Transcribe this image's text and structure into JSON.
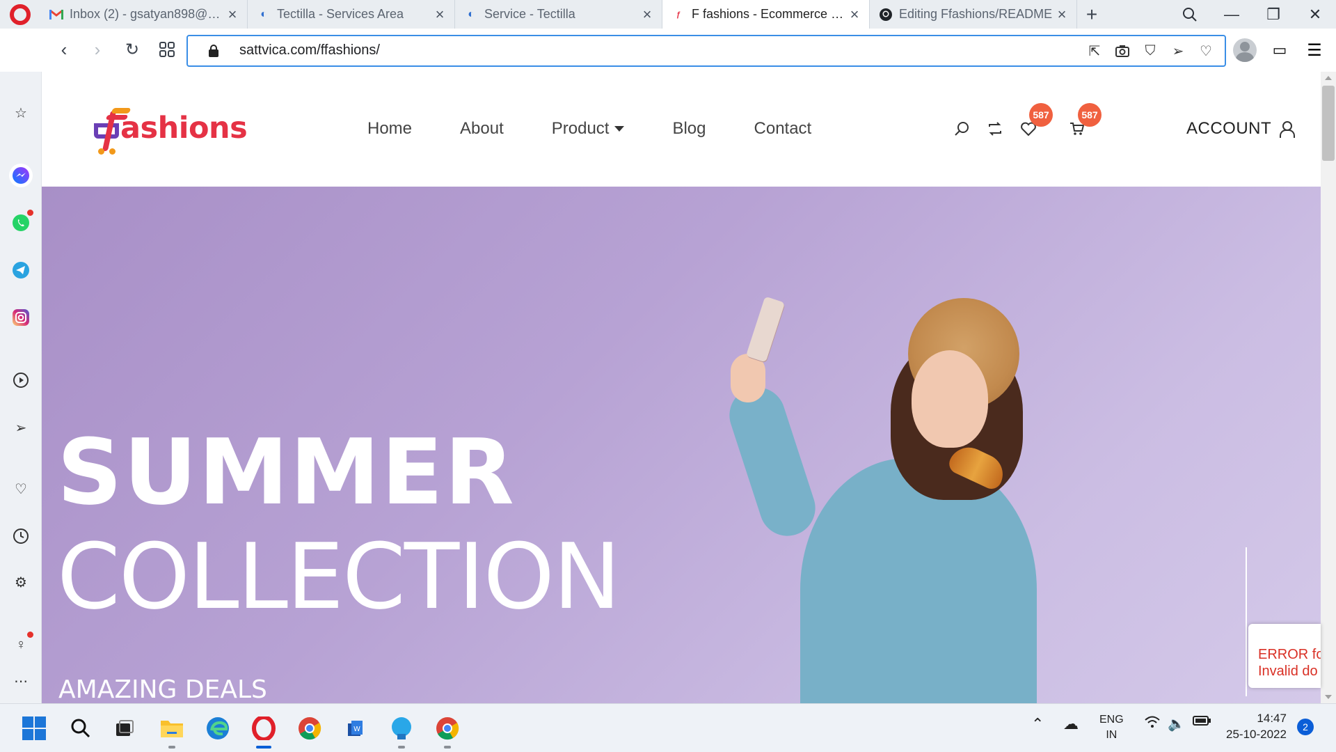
{
  "browser": {
    "tabs": [
      {
        "title": "Inbox (2) - gsatyan898@gm",
        "favicon": "gmail-icon",
        "active": false
      },
      {
        "title": "Tectilla - Services Area",
        "favicon": "tectilla-icon",
        "active": false
      },
      {
        "title": "Service - Tectilla",
        "favicon": "tectilla-icon",
        "active": false
      },
      {
        "title": "F fashions - Ecommerce Sys",
        "favicon": "ffashions-icon",
        "active": true
      },
      {
        "title": "Editing Ffashions/README",
        "favicon": "github-icon",
        "active": false
      }
    ],
    "url": "sattvica.com/ffashions/"
  },
  "site": {
    "logo_text": "ashions",
    "nav": [
      "Home",
      "About",
      "Product",
      "Blog",
      "Contact"
    ],
    "wishlist_count": "587",
    "cart_count": "587",
    "account_label": "ACCOUNT",
    "hero": {
      "line1": "SUMMER",
      "line2": "COLLECTION",
      "line3": "AMAZING DEALS"
    }
  },
  "error_widget": {
    "line1": "ERROR fo",
    "line2": "Invalid do"
  },
  "taskbar": {
    "language_line1": "ENG",
    "language_line2": "IN",
    "time": "14:47",
    "date": "25-10-2022",
    "notification_count": "2"
  },
  "colors": {
    "brand_red": "#e53245",
    "brand_purple": "#6a3fb5",
    "brand_orange": "#f2991a",
    "badge": "#f0603f",
    "hero_bg": "#b7a2d4",
    "url_focus": "#3a8ee6"
  }
}
